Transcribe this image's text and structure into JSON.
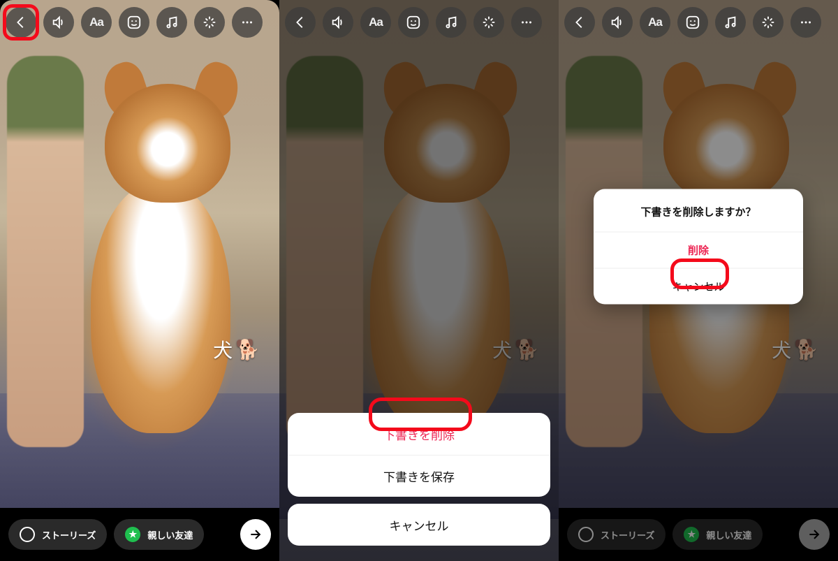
{
  "toolbar": {
    "icons": [
      "back",
      "sound",
      "text",
      "sticker",
      "music",
      "sparkle",
      "more"
    ],
    "aa_label": "Aa"
  },
  "sticker": {
    "text": "犬",
    "emoji": "🐕"
  },
  "share": {
    "stories_label": "ストーリーズ",
    "close_friends_label": "親しい友達"
  },
  "sheet": {
    "delete_draft": "下書きを削除",
    "save_draft": "下書きを保存",
    "cancel": "キャンセル"
  },
  "dialog": {
    "title": "下書きを削除しますか？",
    "delete": "削除",
    "cancel": "キャンセル"
  }
}
